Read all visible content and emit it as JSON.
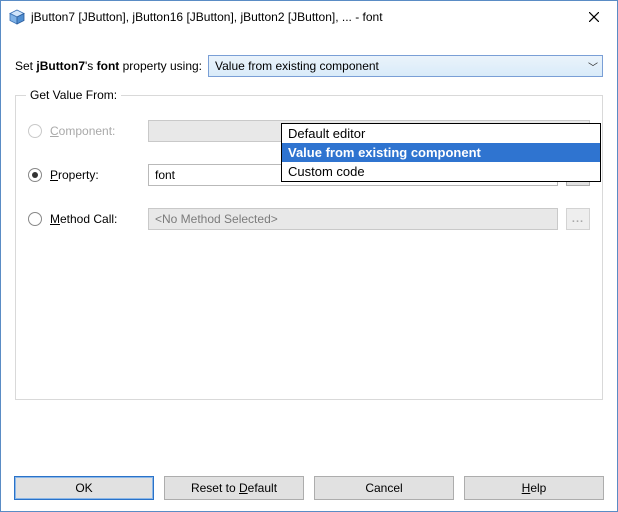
{
  "window": {
    "title": "jButton7 [JButton], jButton16 [JButton], jButton2 [JButton], ... - font"
  },
  "setline": {
    "prefix": "Set ",
    "bold1": "jButton7",
    "mid": "'s ",
    "bold2": "font",
    "suffix": " property using:"
  },
  "combo": {
    "selected": "Value from existing component",
    "options": {
      "0": "Default editor",
      "1": "Value from existing component",
      "2": "Custom code"
    }
  },
  "group": {
    "legend": "Get Value From:",
    "component": {
      "label_pre": "",
      "label_ul": "C",
      "label_post": "omponent:",
      "value": ""
    },
    "property": {
      "label_pre": "",
      "label_ul": "P",
      "label_post": "roperty:",
      "value": "font",
      "dots": "..."
    },
    "method": {
      "label_pre": "",
      "label_ul": "M",
      "label_post": "ethod Call:",
      "placeholder": "<No Method Selected>",
      "dots": "..."
    }
  },
  "buttons": {
    "ok": "OK",
    "reset_pre": "Reset to ",
    "reset_ul": "D",
    "reset_post": "efault",
    "cancel": "Cancel",
    "help_ul": "H",
    "help_post": "elp"
  }
}
